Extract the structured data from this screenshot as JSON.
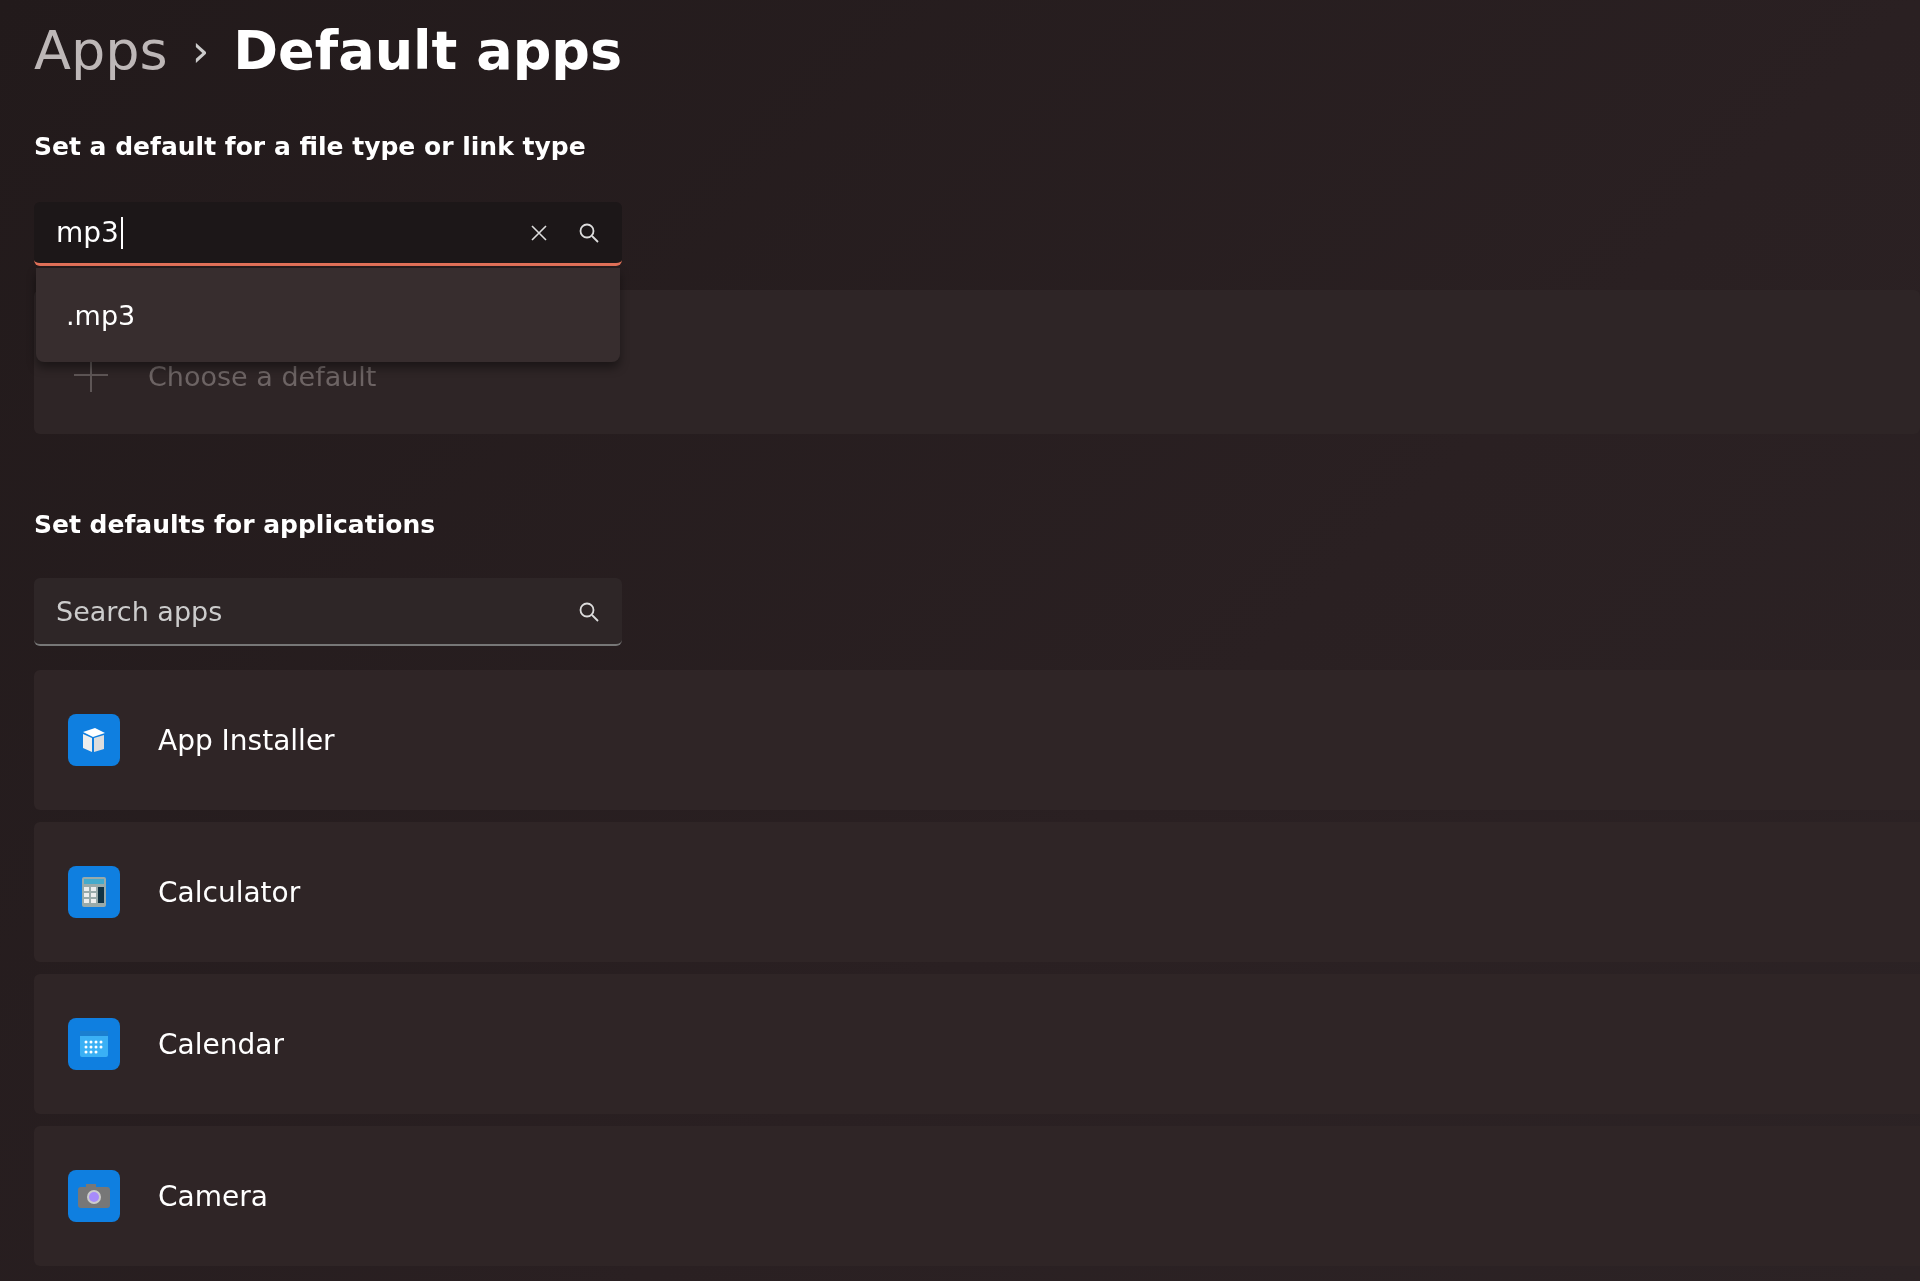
{
  "breadcrumb": {
    "parent": "Apps",
    "separator": "›",
    "current": "Default apps"
  },
  "file_type_section": {
    "heading": "Set a default for a file type or link type",
    "search": {
      "value": "mp3"
    },
    "suggestions": [
      ".mp3"
    ],
    "choose_default": "Choose a default"
  },
  "apps_section": {
    "heading": "Set defaults for applications",
    "search": {
      "placeholder": "Search apps"
    },
    "apps": [
      {
        "name": "App Installer",
        "kind": "installer"
      },
      {
        "name": "Calculator",
        "kind": "calculator"
      },
      {
        "name": "Calendar",
        "kind": "calendar"
      },
      {
        "name": "Camera",
        "kind": "camera"
      }
    ]
  }
}
